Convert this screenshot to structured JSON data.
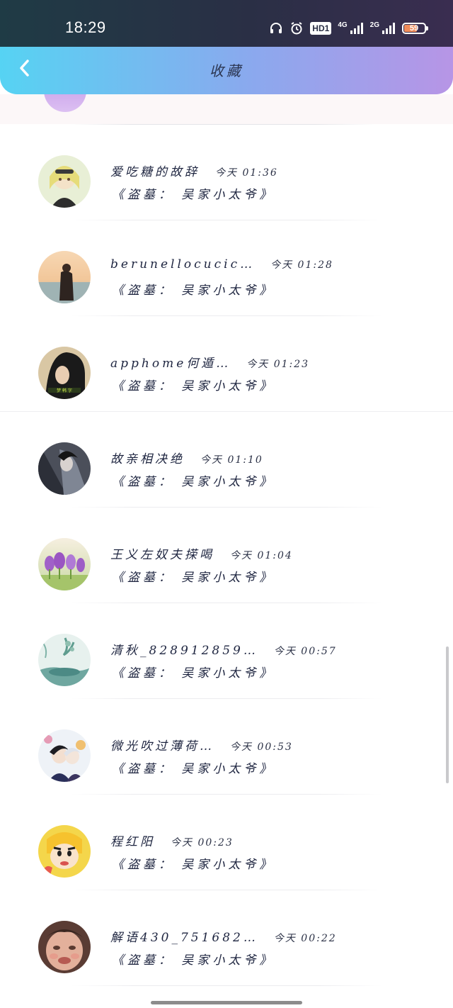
{
  "status_bar": {
    "time": "18:29",
    "network_label": "4G",
    "network_label_2": "2G",
    "hd_label": "HD1",
    "battery_level": "59",
    "icons": [
      "headset-icon",
      "alarm-icon",
      "hd-icon",
      "signal-4g-icon",
      "signal-2g-icon",
      "battery-icon"
    ]
  },
  "header": {
    "title": "收藏",
    "back_icon": "chevron-left-icon"
  },
  "colors": {
    "header_gradient_start": "#56d3f3",
    "header_gradient_end": "#b795e6",
    "status_bar_bg": "#2a2f45",
    "text_primary": "#1e2540"
  },
  "favorites": [
    {
      "name": "爱吃糖的故辞",
      "time": "今天 01:36",
      "book": "《盗墓： 吴家小太爷》",
      "avatar": "anime-girl-avatar"
    },
    {
      "name": "berunellocucic…",
      "time": "今天 01:28",
      "book": "《盗墓： 吴家小太爷》",
      "avatar": "sunset-figure-avatar"
    },
    {
      "name": "apphome何遁…",
      "time": "今天 01:23",
      "book": "《盗墓： 吴家小太爷》",
      "avatar": "dark-portrait-avatar"
    },
    {
      "name": "故亲相决绝",
      "time": "今天 01:10",
      "book": "《盗墓： 吴家小太爷》",
      "avatar": "warrior-avatar"
    },
    {
      "name": "王义左奴夫㨲喝",
      "time": "今天 01:04",
      "book": "《盗墓： 吴家小太爷》",
      "avatar": "purple-flowers-avatar"
    },
    {
      "name": "清秋_828912859…",
      "time": "今天 00:57",
      "book": "《盗墓： 吴家小太爷》",
      "avatar": "ink-landscape-avatar"
    },
    {
      "name": "微光吹过薄荷…",
      "time": "今天 00:53",
      "book": "《盗墓： 吴家小太爷》",
      "avatar": "anime-duo-avatar"
    },
    {
      "name": "程红阳",
      "time": "今天 00:23",
      "book": "《盗墓： 吴家小太爷》",
      "avatar": "cartoon-boy-avatar"
    },
    {
      "name": "解语430_751682…",
      "time": "今天 00:22",
      "book": "《盗墓： 吴家小太爷》",
      "avatar": "child-face-avatar"
    }
  ]
}
